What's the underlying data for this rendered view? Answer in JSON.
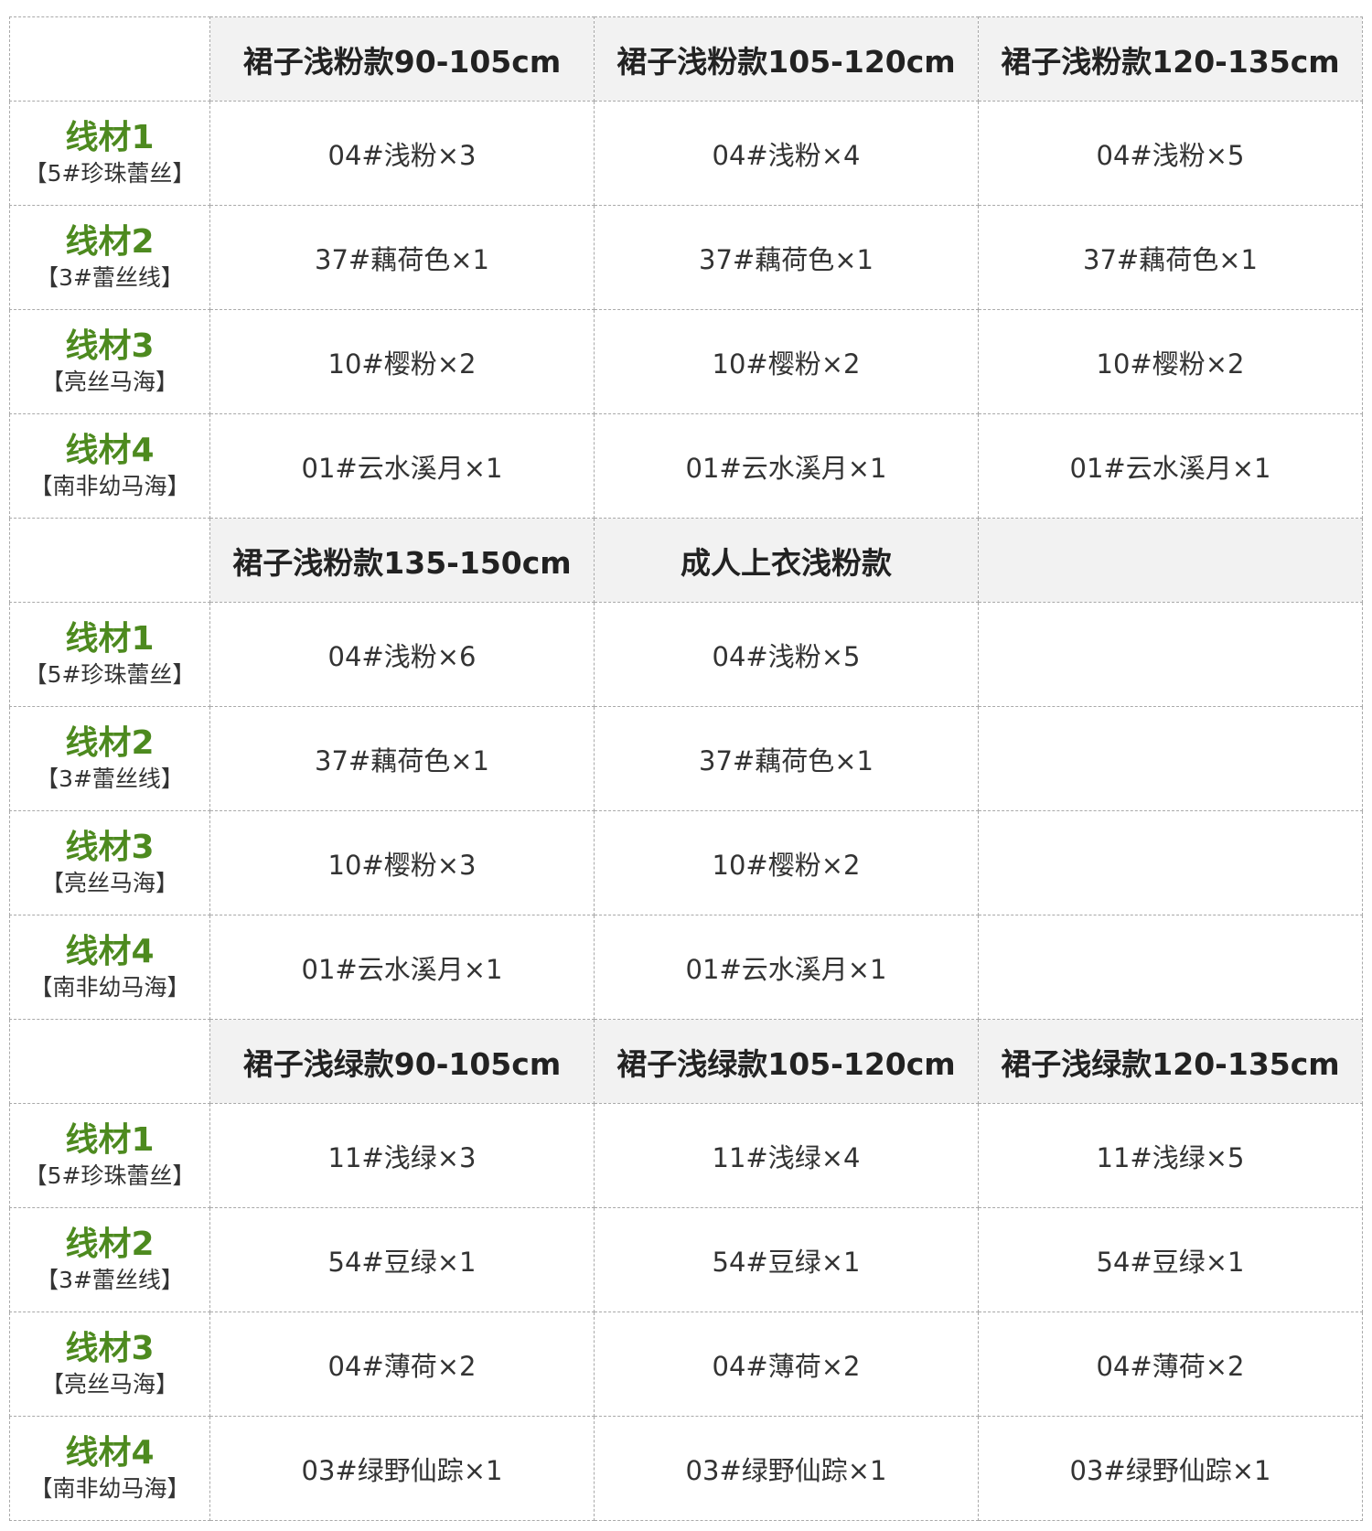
{
  "sections": [
    {
      "headers": [
        "裙子浅粉款90-105cm",
        "裙子浅粉款105-120cm",
        "裙子浅粉款120-135cm"
      ],
      "rows": [
        {
          "name": "线材1",
          "sub": "【5#珍珠蕾丝】",
          "values": [
            "04#浅粉×3",
            "04#浅粉×4",
            "04#浅粉×5"
          ]
        },
        {
          "name": "线材2",
          "sub": "【3#蕾丝线】",
          "values": [
            "37#藕荷色×1",
            "37#藕荷色×1",
            "37#藕荷色×1"
          ]
        },
        {
          "name": "线材3",
          "sub": "【亮丝马海】",
          "values": [
            "10#樱粉×2",
            "10#樱粉×2",
            "10#樱粉×2"
          ]
        },
        {
          "name": "线材4",
          "sub": "【南非幼马海】",
          "values": [
            "01#云水溪月×1",
            "01#云水溪月×1",
            "01#云水溪月×1"
          ]
        }
      ]
    },
    {
      "headers": [
        "裙子浅粉款135-150cm",
        "成人上衣浅粉款",
        ""
      ],
      "rows": [
        {
          "name": "线材1",
          "sub": "【5#珍珠蕾丝】",
          "values": [
            "04#浅粉×6",
            "04#浅粉×5",
            ""
          ]
        },
        {
          "name": "线材2",
          "sub": "【3#蕾丝线】",
          "values": [
            "37#藕荷色×1",
            "37#藕荷色×1",
            ""
          ]
        },
        {
          "name": "线材3",
          "sub": "【亮丝马海】",
          "values": [
            "10#樱粉×3",
            "10#樱粉×2",
            ""
          ]
        },
        {
          "name": "线材4",
          "sub": "【南非幼马海】",
          "values": [
            "01#云水溪月×1",
            "01#云水溪月×1",
            ""
          ]
        }
      ]
    },
    {
      "headers": [
        "裙子浅绿款90-105cm",
        "裙子浅绿款105-120cm",
        "裙子浅绿款120-135cm"
      ],
      "rows": [
        {
          "name": "线材1",
          "sub": "【5#珍珠蕾丝】",
          "values": [
            "11#浅绿×3",
            "11#浅绿×4",
            "11#浅绿×5"
          ]
        },
        {
          "name": "线材2",
          "sub": "【3#蕾丝线】",
          "values": [
            "54#豆绿×1",
            "54#豆绿×1",
            "54#豆绿×1"
          ]
        },
        {
          "name": "线材3",
          "sub": "【亮丝马海】",
          "values": [
            "04#薄荷×2",
            "04#薄荷×2",
            "04#薄荷×2"
          ]
        },
        {
          "name": "线材4",
          "sub": "【南非幼马海】",
          "values": [
            "03#绿野仙踪×1",
            "03#绿野仙踪×1",
            "03#绿野仙踪×1"
          ]
        }
      ]
    }
  ],
  "colors": {
    "label_green": "#4d8a1f",
    "header_bg": "#f2f2f2",
    "border": "#a9a9a9",
    "text": "#333333"
  }
}
